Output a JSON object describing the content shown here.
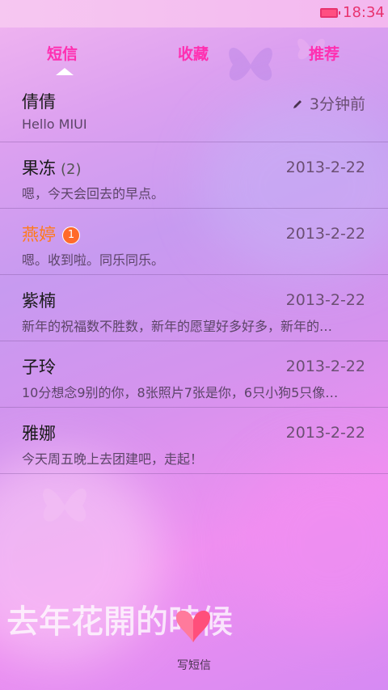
{
  "status_bar": {
    "time": "18:34"
  },
  "tabs": [
    {
      "label": "短信",
      "active": true
    },
    {
      "label": "收藏",
      "active": false
    },
    {
      "label": "推荐",
      "active": false
    }
  ],
  "threads": [
    {
      "name": "倩倩",
      "count": "",
      "unread": "",
      "time": "3分钟前",
      "preview": "Hello MIUI",
      "draft": true
    },
    {
      "name": "果冻",
      "count": "(2)",
      "unread": "",
      "time": "2013-2-22",
      "preview": "嗯，今天会回去的早点。",
      "draft": false
    },
    {
      "name": "燕婷",
      "count": "",
      "unread": "1",
      "time": "2013-2-22",
      "preview": "嗯。收到啦。同乐同乐。",
      "draft": false
    },
    {
      "name": "紫楠",
      "count": "",
      "unread": "",
      "time": "2013-2-22",
      "preview": "新年的祝福数不胜数，新年的愿望好多好多，新年的…",
      "draft": false
    },
    {
      "name": "子玲",
      "count": "",
      "unread": "",
      "time": "2013-2-22",
      "preview": "10分想念9别的你，8张照片7张是你，6只小狗5只像…",
      "draft": false
    },
    {
      "name": "雅娜",
      "count": "",
      "unread": "",
      "time": "2013-2-22",
      "preview": "今天周五晚上去团建吧，走起！",
      "draft": false
    }
  ],
  "compose": {
    "label": "写短信",
    "icon": "heart-icon"
  },
  "wallpaper_text": "去年花開的時候",
  "colors": {
    "accent": "#ff2fb0",
    "unread": "#ff7a1a",
    "status": "#e8336f"
  }
}
